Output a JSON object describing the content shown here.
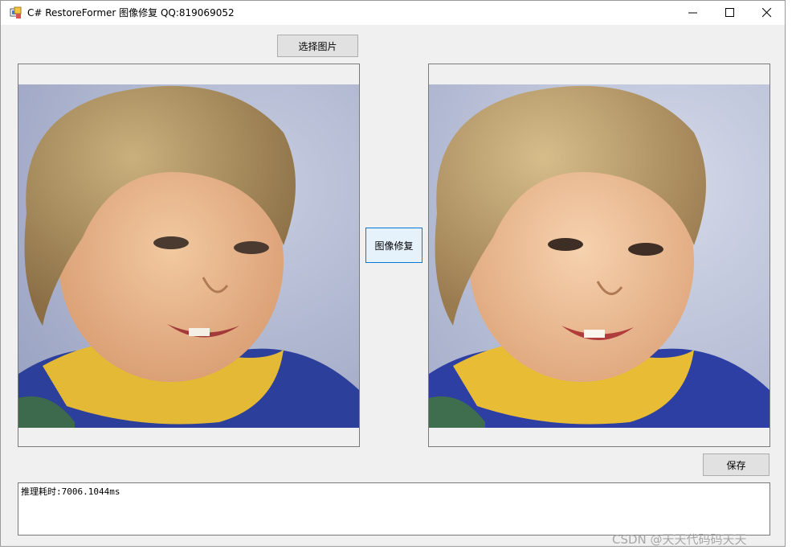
{
  "window": {
    "title": "C# RestoreFormer 图像修复 QQ:819069052"
  },
  "buttons": {
    "select_image": "选择图片",
    "restore": "图像修复",
    "save": "保存"
  },
  "images": {
    "original": "blurry-baby-portrait",
    "restored": "restored-baby-portrait"
  },
  "log": {
    "text": "推理耗时:7006.1044ms"
  },
  "watermark": "CSDN @天天代码码天天",
  "colors": {
    "window_bg": "#f0f0f0",
    "focus_border": "#0078d7"
  }
}
